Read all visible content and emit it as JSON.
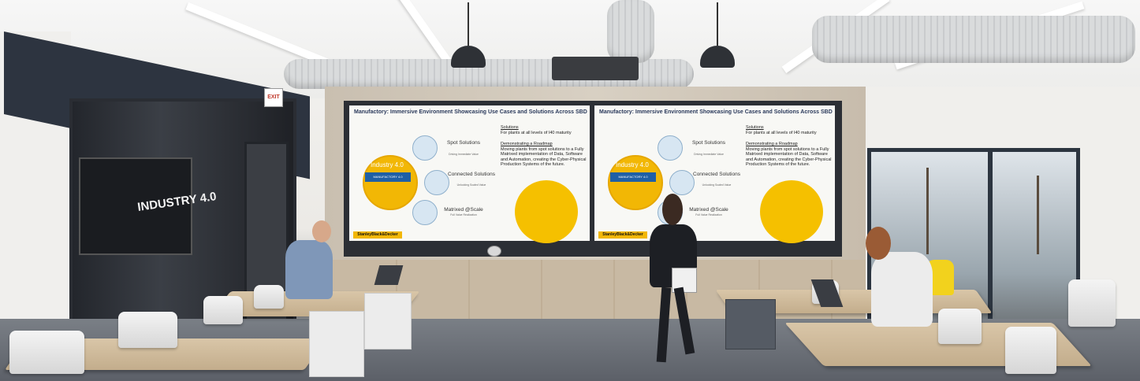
{
  "scene": {
    "room": "Manufactory showroom",
    "exit_sign": "EXIT",
    "glass_wall_text": "INDUSTRY 4.0"
  },
  "screens": [
    {
      "title": "Manufactory: Immersive Environment Showcasing Use Cases and Solutions Across SBD",
      "hub_label": "Industry 4.0",
      "hub_badge": "MANUFACTORY 4.0",
      "steps": [
        {
          "title": "Spot Solutions",
          "sub": "Driving Immediate Value"
        },
        {
          "title": "Connected Solutions",
          "sub": "Unlocking Scaled Value"
        },
        {
          "title": "Matrixed @Scale",
          "sub": "Full Value Realization"
        }
      ],
      "solutions_head": "Solutions",
      "solutions_text": "For plants at all levels of I40 maturity",
      "roadmap_head": "Demonstrating a Roadmap",
      "roadmap_text": "Moving plants from spot solutions to a Fully Matrixed implementation of Data, Software and Automation, creating the Cyber-Physical Production Systems of the future.",
      "brand": "StanleyBlack&Decker"
    },
    {
      "title": "Manufactory: Immersive Environment Showcasing Use Cases and Solutions Across SBD",
      "hub_label": "Industry 4.0",
      "hub_badge": "MANUFACTORY 4.0",
      "steps": [
        {
          "title": "Spot Solutions",
          "sub": "Driving Immediate Value"
        },
        {
          "title": "Connected Solutions",
          "sub": "Unlocking Scaled Value"
        },
        {
          "title": "Matrixed @Scale",
          "sub": "Full Value Realization"
        }
      ],
      "solutions_head": "Solutions",
      "solutions_text": "For plants at all levels of I40 maturity",
      "roadmap_head": "Demonstrating a Roadmap",
      "roadmap_text": "Moving plants from spot solutions to a Fully Matrixed implementation of Data, Software and Automation, creating the Cyber-Physical Production Systems of the future.",
      "brand": "StanleyBlack&Decker"
    }
  ],
  "colors": {
    "accent_yellow": "#f2b705",
    "screen_title": "#2b3a5c",
    "frame_dark": "#2d3440"
  }
}
